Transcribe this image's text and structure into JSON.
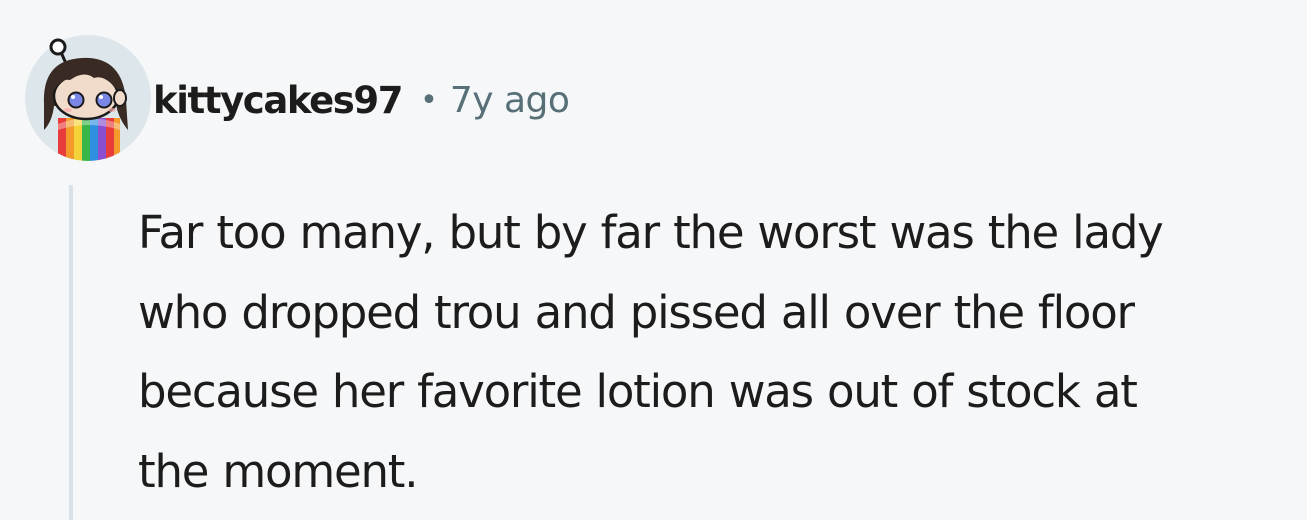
{
  "comment": {
    "author": "kittycakes97",
    "separator": "•",
    "age": "7y ago",
    "body_lines": [
      "Far too many, but by far the worst was the lady",
      "who dropped trou and pissed all over the floor",
      "because her favorite lotion was out of stock at",
      "the moment."
    ],
    "avatar": {
      "icon": "snoo-avatar-icon",
      "colors": {
        "hair": "#3a2a24",
        "skin": "#f1dccb",
        "eyes": "#7b87e6",
        "jacket_stripes": [
          "#e83b3b",
          "#f39a2b",
          "#f4d23a",
          "#39b54a",
          "#2f8fe0",
          "#8a4fd0"
        ],
        "circle_bg": "#dde6ea"
      }
    }
  }
}
